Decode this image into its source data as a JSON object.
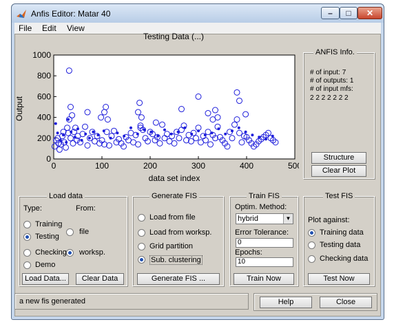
{
  "window": {
    "title": "Anfis Editor: Matar 40",
    "controls": {
      "minimize": "–",
      "maximize": "□",
      "close": "✕"
    }
  },
  "menu": [
    "File",
    "Edit",
    "View"
  ],
  "plot": {
    "title": "Testing Data (...)",
    "xlabel": "data set index",
    "ylabel": "Output"
  },
  "chart_data": {
    "type": "scatter",
    "title": "Testing Data (...)",
    "xlabel": "data set index",
    "ylabel": "Output",
    "xlim": [
      0,
      500
    ],
    "ylim": [
      0,
      1000
    ],
    "xticks": [
      0,
      100,
      200,
      300,
      400,
      500
    ],
    "yticks": [
      0,
      200,
      400,
      600,
      800,
      1000
    ],
    "grid": false,
    "series": [
      {
        "marker": "open-circle",
        "color": "#1d1ddb",
        "x": [
          2,
          5,
          8,
          10,
          12,
          15,
          18,
          20,
          22,
          25,
          28,
          30,
          32,
          35,
          38,
          40,
          42,
          45,
          48,
          50,
          55,
          60,
          65,
          70,
          75,
          80,
          85,
          90,
          95,
          100,
          105,
          110,
          115,
          120,
          125,
          130,
          135,
          140,
          145,
          150,
          155,
          160,
          165,
          170,
          175,
          180,
          185,
          190,
          195,
          200,
          205,
          210,
          215,
          220,
          225,
          230,
          235,
          240,
          245,
          250,
          255,
          260,
          265,
          270,
          275,
          280,
          285,
          290,
          295,
          300,
          305,
          310,
          315,
          320,
          325,
          330,
          335,
          340,
          345,
          350,
          355,
          360,
          365,
          370,
          375,
          380,
          385,
          390,
          395,
          400,
          405,
          410,
          415,
          420,
          425,
          430,
          435,
          440,
          445,
          450,
          455,
          460,
          32,
          35,
          70,
          98,
          105,
          108,
          112,
          175,
          178,
          180,
          182,
          212,
          265,
          300,
          320,
          330,
          335,
          340,
          380,
          385,
          398
        ],
        "y": [
          120,
          180,
          200,
          150,
          90,
          140,
          220,
          260,
          160,
          110,
          300,
          250,
          380,
          200,
          420,
          150,
          260,
          300,
          180,
          220,
          160,
          240,
          310,
          130,
          200,
          260,
          170,
          220,
          150,
          180,
          140,
          260,
          130,
          220,
          270,
          160,
          190,
          150,
          120,
          210,
          180,
          250,
          160,
          230,
          140,
          300,
          280,
          200,
          170,
          260,
          240,
          180,
          210,
          150,
          330,
          200,
          240,
          170,
          220,
          150,
          260,
          200,
          280,
          320,
          180,
          230,
          170,
          250,
          200,
          300,
          160,
          220,
          180,
          260,
          140,
          230,
          200,
          310,
          210,
          180,
          150,
          120,
          260,
          200,
          330,
          380,
          250,
          160,
          220,
          210,
          180,
          150,
          120,
          140,
          170,
          190,
          210,
          230,
          250,
          200,
          180,
          160,
          850,
          500,
          450,
          400,
          450,
          500,
          380,
          450,
          540,
          320,
          400,
          350,
          480,
          600,
          440,
          380,
          470,
          400,
          640,
          560,
          430
        ]
      },
      {
        "marker": "dot",
        "color": "#1d1ddb",
        "x": [
          4,
          8,
          14,
          20,
          26,
          30,
          36,
          44,
          50,
          58,
          66,
          74,
          82,
          92,
          104,
          118,
          132,
          146,
          160,
          174,
          188,
          202,
          216,
          230,
          244,
          258,
          272,
          286,
          300,
          314,
          328,
          342,
          356,
          370,
          384,
          398,
          412,
          426,
          440,
          454
        ],
        "y": [
          340,
          250,
          180,
          230,
          160,
          380,
          260,
          210,
          290,
          180,
          240,
          200,
          260,
          230,
          270,
          200,
          250,
          220,
          300,
          240,
          280,
          260,
          220,
          280,
          240,
          260,
          300,
          240,
          270,
          230,
          250,
          290,
          240,
          270,
          300,
          260,
          230,
          210,
          190,
          220
        ]
      }
    ]
  },
  "anfis_info": {
    "title": "ANFIS Info.",
    "lines": [
      "# of input: 7",
      "# of outputs: 1",
      "# of input mfs:",
      "2 2 2 2 2 2 2"
    ],
    "structure_btn": "Structure",
    "clearplot_btn": "Clear Plot"
  },
  "load_data": {
    "title": "Load data",
    "type_label": "Type:",
    "from_label": "From:",
    "types": [
      {
        "label": "Training",
        "selected": false
      },
      {
        "label": "Testing",
        "selected": true
      },
      {
        "label": "Checking",
        "selected": false
      },
      {
        "label": "Demo",
        "selected": false
      }
    ],
    "sources": [
      {
        "label": "file",
        "selected": false
      },
      {
        "label": "worksp.",
        "selected": true
      }
    ],
    "load_btn": "Load Data...",
    "clear_btn": "Clear Data"
  },
  "generate_fis": {
    "title": "Generate FIS",
    "options": [
      {
        "label": "Load from file",
        "selected": false
      },
      {
        "label": "Load from worksp.",
        "selected": false
      },
      {
        "label": "Grid partition",
        "selected": false
      },
      {
        "label": "Sub. clustering",
        "selected": true
      }
    ],
    "generate_btn": "Generate FIS ..."
  },
  "train_fis": {
    "title": "Train FIS",
    "optim_label": "Optim. Method:",
    "optim_value": "hybrid",
    "error_label": "Error Tolerance:",
    "error_value": "0",
    "epochs_label": "Epochs:",
    "epochs_value": "10",
    "train_btn": "Train Now"
  },
  "test_fis": {
    "title": "Test FIS",
    "plot_against": "Plot against:",
    "options": [
      {
        "label": "Training data",
        "selected": true
      },
      {
        "label": "Testing data",
        "selected": false
      },
      {
        "label": "Checking data",
        "selected": false
      }
    ],
    "test_btn": "Test Now"
  },
  "status": {
    "message": "a new fis generated"
  },
  "footer": {
    "help_btn": "Help",
    "close_btn": "Close"
  }
}
